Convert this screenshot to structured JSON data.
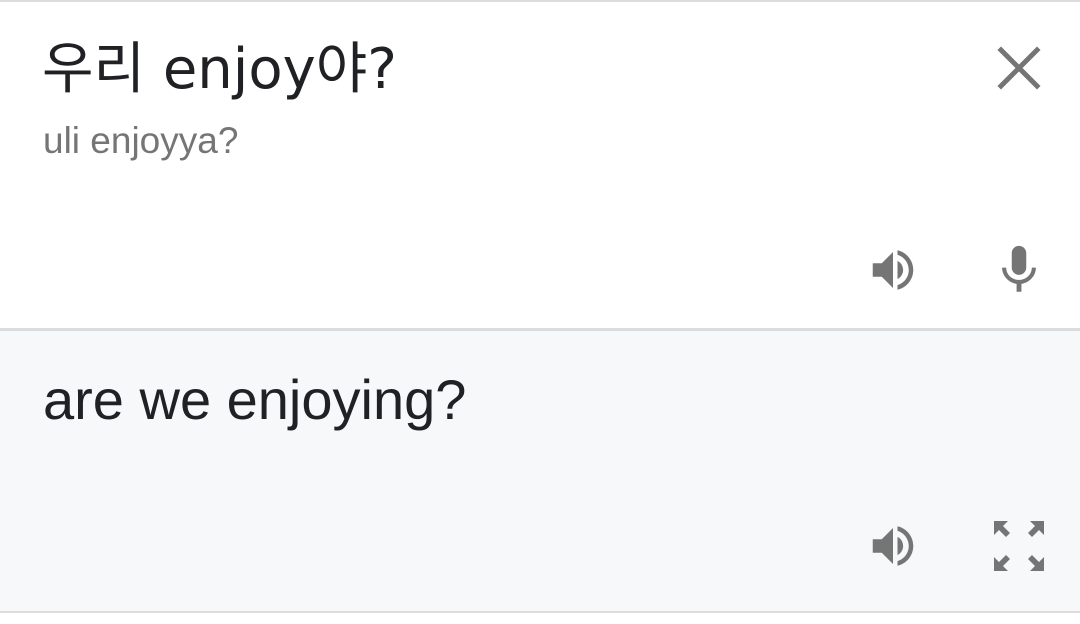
{
  "source": {
    "text": "우리 enjoy야?",
    "romanization": "uli enjoyya?"
  },
  "translation": {
    "text": "are we enjoying?"
  },
  "icons": {
    "clear": "close-icon",
    "source_speak": "volume-icon",
    "voice_input": "microphone-icon",
    "target_speak": "volume-icon",
    "fullscreen": "fullscreen-icon"
  },
  "colors": {
    "icon": "#757575",
    "text": "#202124",
    "secondary_text": "#757575",
    "translation_background": "#f7f8fa"
  }
}
